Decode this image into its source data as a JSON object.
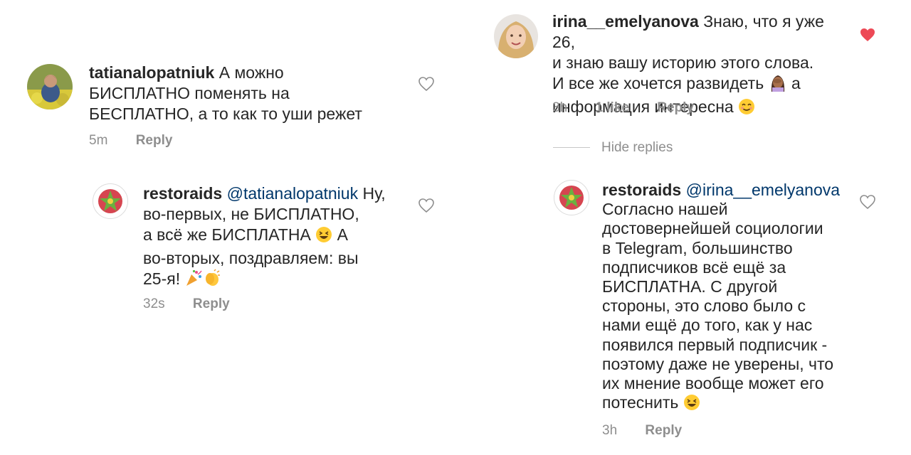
{
  "colors": {
    "text": "#262626",
    "meta": "#8e8e8e",
    "mention": "#00376b",
    "liked_heart": "#ed4956"
  },
  "left": {
    "comment": {
      "username": "tatianalopatniuk",
      "lines": [
        "А можно",
        "БИСПЛАТНО поменять на",
        "БЕСПЛАТНО, а то как то уши режет"
      ],
      "time": "5m",
      "reply": "Reply",
      "heart_icon": "heart-outline-icon"
    },
    "reply": {
      "username": "restoraids",
      "mention": "@tatianalopatniuk",
      "line1_rest": "Ну,",
      "line2": "во-первых, не БИСПЛАТНО,",
      "line3": "а всё же БИСПЛАТНА",
      "line3_tail": "А",
      "line4": "во-вторых, поздравляем: вы",
      "line5": "25-я!",
      "time": "32s",
      "reply": "Reply",
      "heart_icon": "heart-outline-icon"
    }
  },
  "right": {
    "comment": {
      "username": "irina__emelyanova",
      "line1_rest": "Знаю, что я уже 26,",
      "line2": "и знаю вашу историю этого слова.",
      "line3": "И все же хочется развидеть",
      "line3_tail": "а",
      "line4": "информация интересна",
      "time": "3h",
      "likes": "1 like",
      "reply": "Reply",
      "heart_icon": "heart-filled-icon"
    },
    "hide_replies": "Hide replies",
    "reply": {
      "username": "restoraids",
      "mention": "@irina__emelyanova",
      "lines": [
        "Согласно нашей",
        "достовернейшей социологии",
        "в Telegram, большинство",
        "подписчиков всё ещё за",
        "БИСПЛАТНА. С другой",
        "стороны, это слово было с",
        "нами ещё до того, как у нас",
        "появился первый подписчик -",
        "поэтому даже не уверены, что",
        "их мнение вообще может его"
      ],
      "last_line": "потеснить",
      "time": "3h",
      "reply": "Reply",
      "heart_icon": "heart-outline-icon"
    }
  }
}
